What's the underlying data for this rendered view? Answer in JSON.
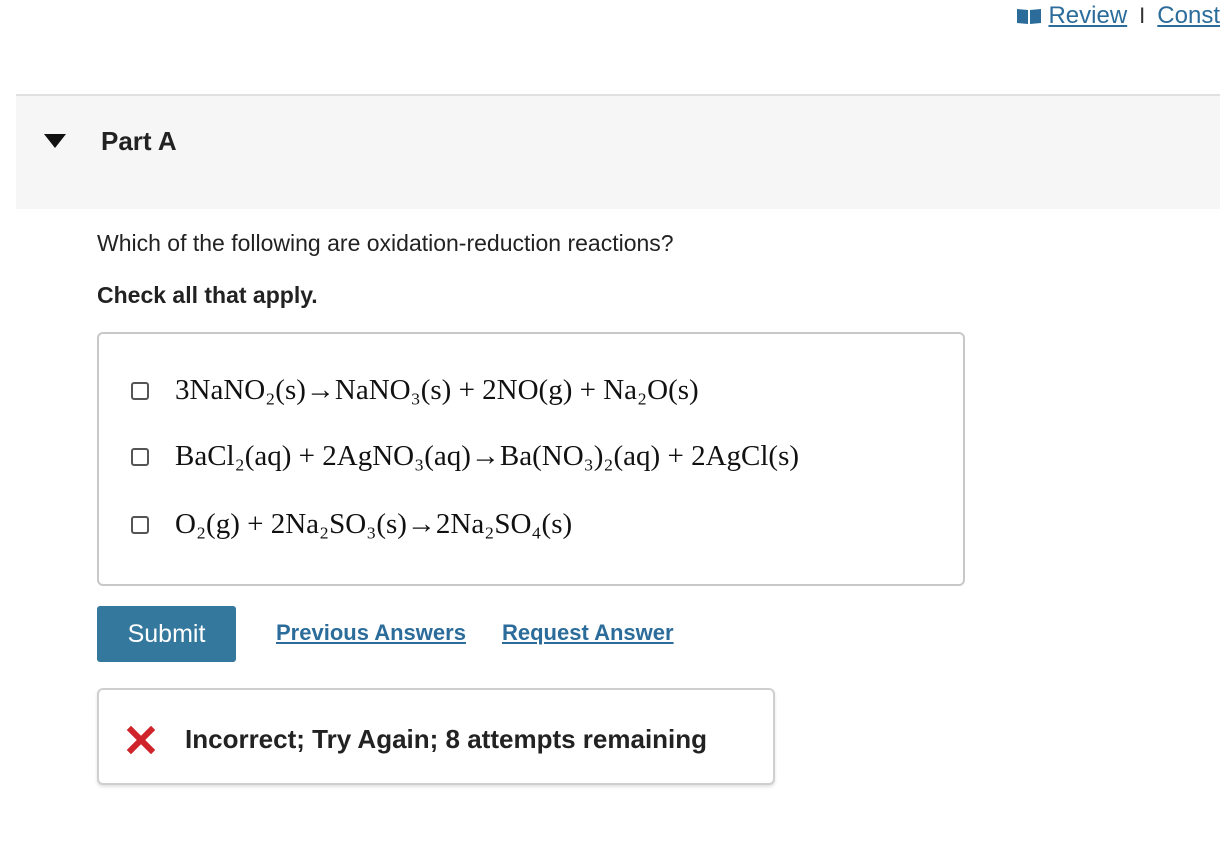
{
  "toplinks": {
    "icon": "book-icon",
    "review_label": "Review",
    "separator": "I",
    "constants_label": "Const"
  },
  "part": {
    "collapse_icon": "caret-down-icon",
    "title": "Part A"
  },
  "question": {
    "prompt": "Which of the following are oxidation-reduction reactions?",
    "instruction": "Check all that apply."
  },
  "options": [
    {
      "checked": false,
      "formula": "3NaNO₂(s)→NaNO₃(s) + 2NO(g) + Na₂O(s)"
    },
    {
      "checked": false,
      "formula": "BaCl₂(aq) + 2AgNO₃(aq)→Ba(NO₃)₂(aq) + 2AgCl(s)"
    },
    {
      "checked": false,
      "formula": "O₂(g) + 2Na₂SO₃(s)→2Na₂SO₄(s)"
    }
  ],
  "actions": {
    "submit_label": "Submit",
    "previous_answers_label": "Previous Answers",
    "request_answer_label": "Request Answer"
  },
  "feedback": {
    "icon": "x-icon",
    "icon_color": "#d0242b",
    "text": "Incorrect; Try Again; 8 attempts remaining"
  },
  "colors": {
    "accent": "#34789d",
    "link": "#2b6c9b"
  }
}
